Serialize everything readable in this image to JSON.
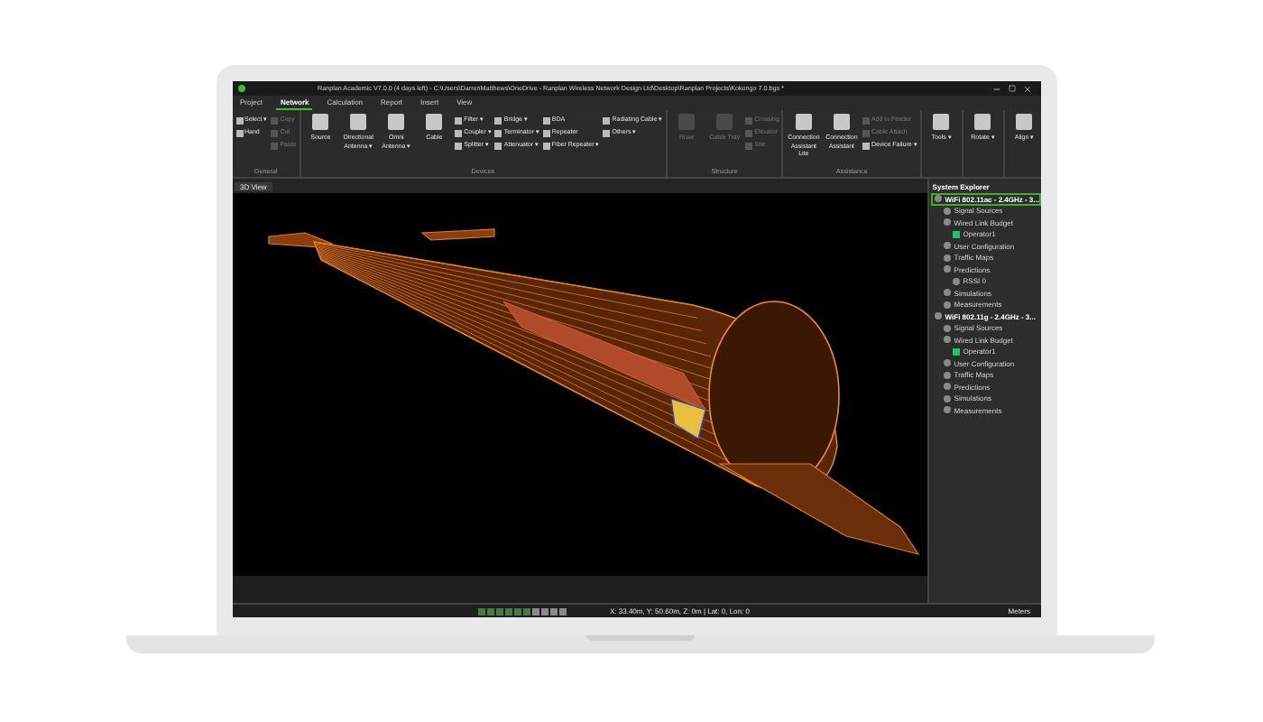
{
  "window": {
    "title": "Ranplan Academic V7.0.0 (4 days left) - C:\\Users\\DarrenMatthews\\OneDrive - Ranplan Wireless Network Design Ltd\\Desktop\\Ranplan Projects\\Kokongo 7.0.bgs *"
  },
  "tabs": [
    {
      "label": "Project",
      "selected": false
    },
    {
      "label": "Network",
      "selected": true
    },
    {
      "label": "Calculation",
      "selected": false
    },
    {
      "label": "Report",
      "selected": false
    },
    {
      "label": "Insert",
      "selected": false
    },
    {
      "label": "View",
      "selected": false
    }
  ],
  "ribbon": [
    {
      "name": "General",
      "columns": [
        [
          {
            "label": "Select ▾",
            "disabled": false
          },
          {
            "label": "Hand",
            "disabled": false
          }
        ],
        [
          {
            "label": "Copy",
            "disabled": true
          },
          {
            "label": "Cut",
            "disabled": true
          },
          {
            "label": "Paste",
            "disabled": true
          }
        ]
      ]
    },
    {
      "name": "Devices",
      "large": [
        {
          "label": "Source",
          "disabled": false
        },
        {
          "label": "Directional Antenna ▾",
          "disabled": false
        },
        {
          "label": "Omni Antenna ▾",
          "disabled": false
        },
        {
          "label": "Cable",
          "disabled": false
        }
      ],
      "columns": [
        [
          {
            "label": "Filter ▾",
            "disabled": false
          },
          {
            "label": "Coupler ▾",
            "disabled": false
          },
          {
            "label": "Splitter ▾",
            "disabled": false
          }
        ],
        [
          {
            "label": "Bridge ▾",
            "disabled": false
          },
          {
            "label": "Terminator ▾",
            "disabled": false
          },
          {
            "label": "Attenuator ▾",
            "disabled": false
          }
        ],
        [
          {
            "label": "BDA",
            "disabled": false
          },
          {
            "label": "Repeater",
            "disabled": false
          },
          {
            "label": "Fiber Repeater ▾",
            "disabled": false
          }
        ],
        [
          {
            "label": "Radiating Cable ▾",
            "disabled": false
          },
          {
            "label": "Others ▾",
            "disabled": false
          }
        ]
      ]
    },
    {
      "name": "Structure",
      "large": [
        {
          "label": "Riser",
          "disabled": true
        },
        {
          "label": "Cable Tray",
          "disabled": true
        }
      ],
      "columns": [
        [
          {
            "label": "Crossing",
            "disabled": true
          },
          {
            "label": "Elevator",
            "disabled": true
          },
          {
            "label": "Site",
            "disabled": true
          }
        ]
      ]
    },
    {
      "name": "Assistance",
      "large": [
        {
          "label": "Connection Assistant Lite",
          "disabled": false
        },
        {
          "label": "Connection Assistant",
          "disabled": false
        }
      ],
      "columns": [
        [
          {
            "label": "Add to Feeder",
            "disabled": true
          },
          {
            "label": "Cable Attach",
            "disabled": true
          },
          {
            "label": "Device Failure ▾",
            "disabled": false
          }
        ]
      ]
    },
    {
      "large": [
        {
          "label": "Tools ▾",
          "disabled": false
        }
      ]
    },
    {
      "large": [
        {
          "label": "Rotate ▾",
          "disabled": false
        }
      ]
    },
    {
      "large": [
        {
          "label": "Align ▾",
          "disabled": false
        }
      ]
    }
  ],
  "view_tab": {
    "label": "3D View"
  },
  "explorer": {
    "title": "System Explorer",
    "tree": [
      {
        "label": "WiFi 802.11ac - 2.4GHz - 3...",
        "selected": true,
        "children": [
          {
            "label": "Signal Sources"
          },
          {
            "label": "Wired Link Budget",
            "children": [
              {
                "label": "Operator1",
                "color": "#22c55e"
              }
            ]
          },
          {
            "label": "User Configuration"
          },
          {
            "label": "Traffic Maps"
          },
          {
            "label": "Predictions",
            "children": [
              {
                "label": "RSSI 0"
              }
            ]
          },
          {
            "label": "Simulations"
          },
          {
            "label": "Measurements"
          }
        ]
      },
      {
        "label": "WiFi 802.11g - 2.4GHz - 3...",
        "selected": false,
        "children": [
          {
            "label": "Signal Sources"
          },
          {
            "label": "Wired Link Budget",
            "children": [
              {
                "label": "Operator1",
                "color": "#22c55e"
              }
            ]
          },
          {
            "label": "User Configuration"
          },
          {
            "label": "Traffic Maps"
          },
          {
            "label": "Predictions"
          },
          {
            "label": "Simulations"
          },
          {
            "label": "Measurements"
          }
        ]
      }
    ]
  },
  "status_bar": {
    "coordinates": "X: 33.40m, Y: 50.60m, Z: 0m | Lat: 0, Lon: 0",
    "units": "Meters"
  }
}
